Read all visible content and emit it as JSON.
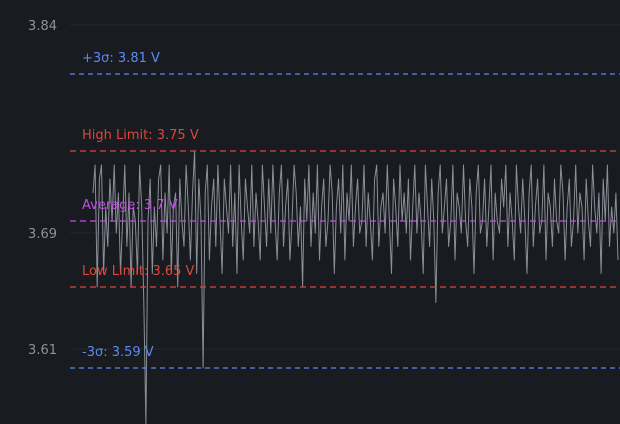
{
  "chart_data": {
    "type": "line",
    "y_ticks": [
      {
        "value": 3.84,
        "label": "3.84"
      },
      {
        "value": 3.69,
        "label": "3.69"
      },
      {
        "value": 3.61,
        "label": "3.61"
      }
    ],
    "reference_lines": [
      {
        "id": "plus3sigma",
        "value": 3.81,
        "label": "+3σ: 3.81 V",
        "color": "#5a8af2",
        "dash": "5 4"
      },
      {
        "id": "high-limit",
        "value": 3.75,
        "label": "High Limit: 3.75 V",
        "color": "#e0453a",
        "dash": "6 4"
      },
      {
        "id": "average",
        "value": 3.7,
        "label": "Average: 3.7 V",
        "color": "#c24fe0",
        "dash": "6 4"
      },
      {
        "id": "low-limit",
        "value": 3.65,
        "label": "Low Limit: 3.65 V",
        "color": "#e0453a",
        "dash": "6 4"
      },
      {
        "id": "minus3sigma",
        "value": 3.59,
        "label": "-3σ: 3.59 V",
        "color": "#5a8af2",
        "dash": "5 4"
      }
    ],
    "series": [
      {
        "color": "#8b8f98",
        "values": [
          3.72,
          3.74,
          3.65,
          3.73,
          3.74,
          3.66,
          3.71,
          3.68,
          3.73,
          3.7,
          3.74,
          3.69,
          3.72,
          3.66,
          3.7,
          3.74,
          3.68,
          3.72,
          3.65,
          3.71,
          3.7,
          3.66,
          3.74,
          3.71,
          3.64,
          3.54,
          3.7,
          3.73,
          3.66,
          3.71,
          3.68,
          3.73,
          3.74,
          3.67,
          3.72,
          3.69,
          3.74,
          3.66,
          3.71,
          3.72,
          3.65,
          3.73,
          3.7,
          3.68,
          3.74,
          3.71,
          3.67,
          3.72,
          3.75,
          3.66,
          3.73,
          3.7,
          3.59,
          3.72,
          3.74,
          3.67,
          3.71,
          3.73,
          3.68,
          3.74,
          3.7,
          3.66,
          3.73,
          3.71,
          3.69,
          3.74,
          3.68,
          3.72,
          3.66,
          3.74,
          3.7,
          3.67,
          3.73,
          3.71,
          3.69,
          3.74,
          3.68,
          3.72,
          3.7,
          3.67,
          3.74,
          3.71,
          3.68,
          3.73,
          3.69,
          3.74,
          3.7,
          3.67,
          3.72,
          3.74,
          3.68,
          3.71,
          3.73,
          3.67,
          3.7,
          3.74,
          3.72,
          3.68,
          3.71,
          3.65,
          3.73,
          3.7,
          3.74,
          3.68,
          3.72,
          3.69,
          3.74,
          3.67,
          3.71,
          3.73,
          3.68,
          3.7,
          3.74,
          3.72,
          3.66,
          3.71,
          3.73,
          3.69,
          3.74,
          3.67,
          3.72,
          3.7,
          3.74,
          3.68,
          3.71,
          3.73,
          3.69,
          3.7,
          3.74,
          3.68,
          3.72,
          3.7,
          3.67,
          3.73,
          3.74,
          3.68,
          3.71,
          3.72,
          3.69,
          3.74,
          3.7,
          3.66,
          3.73,
          3.71,
          3.68,
          3.74,
          3.7,
          3.72,
          3.69,
          3.73,
          3.67,
          3.71,
          3.74,
          3.69,
          3.72,
          3.7,
          3.66,
          3.74,
          3.71,
          3.68,
          3.73,
          3.7,
          3.64,
          3.72,
          3.74,
          3.69,
          3.71,
          3.73,
          3.68,
          3.7,
          3.74,
          3.67,
          3.72,
          3.71,
          3.69,
          3.74,
          3.7,
          3.68,
          3.73,
          3.71,
          3.66,
          3.72,
          3.74,
          3.69,
          3.7,
          3.73,
          3.68,
          3.71,
          3.74,
          3.67,
          3.72,
          3.7,
          3.69,
          3.73,
          3.71,
          3.74,
          3.68,
          3.72,
          3.7,
          3.67,
          3.74,
          3.71,
          3.69,
          3.73,
          3.7,
          3.66,
          3.72,
          3.74,
          3.68,
          3.71,
          3.73,
          3.69,
          3.7,
          3.74,
          3.67,
          3.72,
          3.71,
          3.68,
          3.73,
          3.7,
          3.69,
          3.74,
          3.72,
          3.67,
          3.71,
          3.73,
          3.68,
          3.7,
          3.74,
          3.69,
          3.72,
          3.71,
          3.67,
          3.73,
          3.7,
          3.68,
          3.74,
          3.71,
          3.69,
          3.72,
          3.66,
          3.73,
          3.7,
          3.74,
          3.68,
          3.71,
          3.69,
          3.72,
          3.67
        ]
      }
    ],
    "grid": true,
    "ylim": [
      3.55,
      3.84
    ]
  }
}
